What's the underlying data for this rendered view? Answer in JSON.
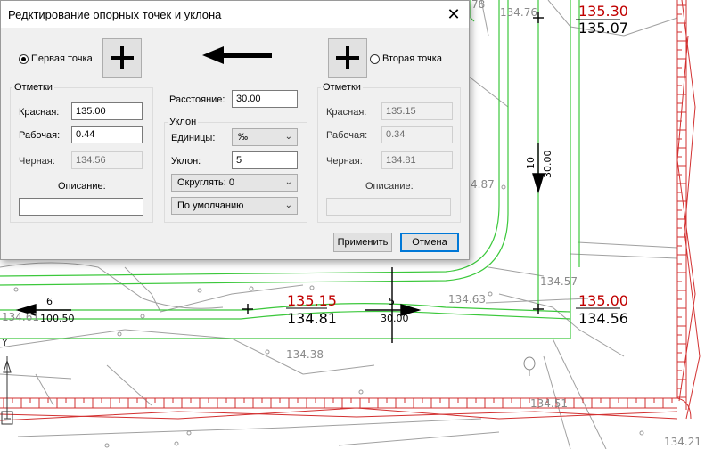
{
  "dialog": {
    "title": "Редктирование опорных точек и уклона",
    "first_point_label": "Первая точка",
    "second_point_label": "Вторая точка",
    "left": {
      "group_title": "Отметки",
      "red_label": "Красная:",
      "red_value": "135.00",
      "work_label": "Рабочая:",
      "work_value": "0.44",
      "black_label": "Черная:",
      "black_value": "134.56",
      "desc_label": "Описание:",
      "desc_value": ""
    },
    "middle": {
      "distance_label": "Расстояние:",
      "distance_value": "30.00",
      "slope_group": "Уклон",
      "units_label": "Единицы:",
      "units_value": "‰",
      "slope_label": "Уклон:",
      "slope_value": "5",
      "round_value": "Округлять: 0",
      "default_value": "По умолчанию"
    },
    "right": {
      "group_title": "Отметки",
      "red_label": "Красная:",
      "red_value": "135.15",
      "work_label": "Рабочая:",
      "work_value": "0.34",
      "black_label": "Черная:",
      "black_value": "134.81",
      "desc_label": "Описание:",
      "desc_value": ""
    },
    "apply_label": "Применить",
    "cancel_label": "Отмена"
  },
  "drawing": {
    "point_top_red": "135.30",
    "point_top_black": "135.07",
    "point_top_gray": "134.76",
    "gray_178": "78",
    "gray_13487": "4.87",
    "vertical_arrow_num": "10",
    "vertical_arrow_dist": "30.00",
    "gray_13457": "134.57",
    "gray_13463": "134.63",
    "point_mid_red": "135.15",
    "point_mid_black": "134.81",
    "point_right_red": "135.00",
    "point_right_black": "134.56",
    "arrow_mid_num": "5",
    "arrow_mid_dist": "30.00",
    "arrow_left_num": "6",
    "arrow_left_dist": "100.50",
    "gray_13461": "134.61",
    "gray_13438": "134.38",
    "gray_13451": "134.51",
    "gray_13421": "134.21",
    "axis_y": "Y",
    "colors": {
      "red": "#c00000",
      "green": "#3cc83c",
      "gray": "#9a9a9a"
    }
  }
}
